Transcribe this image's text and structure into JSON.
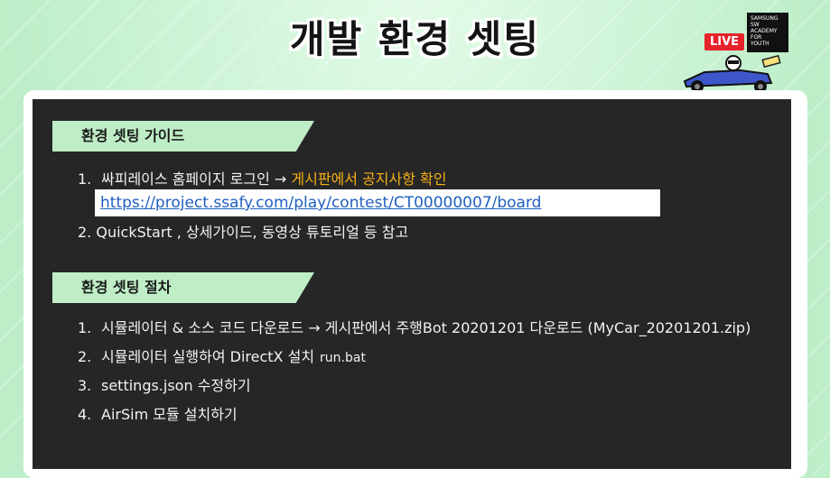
{
  "slide": {
    "title": "개발 환경 셋팅"
  },
  "branding": {
    "live_label": "LIVE",
    "academy_logo_lines": [
      "SAMSUNG",
      "SW",
      "ACADEMY",
      "FOR",
      "YOUTH"
    ],
    "mascot_icon": "race-car-mascot-icon"
  },
  "colors": {
    "background": "#c9f1d2",
    "panel": "#262626",
    "section_header": "#bfeec6",
    "highlight": "#f5b017",
    "link": "#1f5fbf",
    "live_badge": "#e6232a"
  },
  "guide": {
    "header": "환경 셋팅 가이드",
    "items": [
      {
        "num": "1.",
        "text": "싸피레이스 홈페이지 로그인 → ",
        "highlight": "게시판에서 공지사항 확인"
      },
      {
        "num": "2.",
        "text": "QuickStart , 상세가이드, 동영상 튜토리얼 등 참고"
      }
    ],
    "url": "https://project.ssafy.com/play/contest/CT00000007/board"
  },
  "procedure": {
    "header": "환경 셋팅 절차",
    "items": [
      {
        "num": "1.",
        "text": "시뮬레이터 & 소스 코드 다운로드 → 게시판에서 주행Bot 20201201 다운로드 (MyCar_20201201.zip)"
      },
      {
        "num": "2.",
        "text": "시뮬레이터 실행하여 DirectX 설치",
        "note": "run.bat"
      },
      {
        "num": "3.",
        "text": "settings.json 수정하기"
      },
      {
        "num": "4.",
        "text": "AirSim 모듈 설치하기"
      }
    ]
  }
}
